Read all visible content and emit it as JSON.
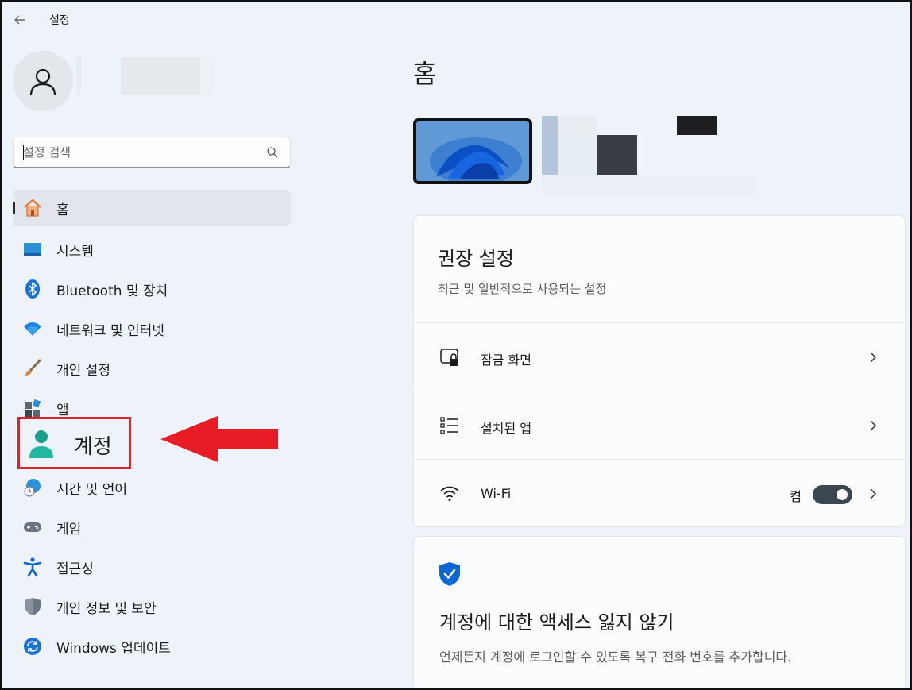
{
  "window": {
    "title": "설정"
  },
  "search": {
    "placeholder": "설정 검색"
  },
  "sidebar": {
    "items": [
      {
        "label": "홈",
        "icon": "home-icon",
        "active": true
      },
      {
        "label": "시스템",
        "icon": "system-icon"
      },
      {
        "label": "Bluetooth 및 장치",
        "icon": "bluetooth-icon"
      },
      {
        "label": "네트워크 및 인터넷",
        "icon": "wifi-icon"
      },
      {
        "label": "개인 설정",
        "icon": "brush-icon"
      },
      {
        "label": "앱",
        "icon": "apps-icon"
      },
      {
        "label": "계정",
        "icon": "account-icon",
        "highlighted": true
      },
      {
        "label": "시간 및 언어",
        "icon": "time-language-icon"
      },
      {
        "label": "게임",
        "icon": "gamepad-icon"
      },
      {
        "label": "접근성",
        "icon": "accessibility-icon"
      },
      {
        "label": "개인 정보 및 보안",
        "icon": "shield-icon"
      },
      {
        "label": "Windows 업데이트",
        "icon": "update-icon"
      }
    ]
  },
  "main": {
    "title": "홈",
    "recommended": {
      "title": "권장 설정",
      "subtitle": "최근 및 일반적으로 사용되는 설정",
      "rows": [
        {
          "label": "잠금 화면",
          "icon": "lock-screen-icon"
        },
        {
          "label": "설치된 앱",
          "icon": "installed-apps-icon"
        },
        {
          "label": "Wi-Fi",
          "icon": "wifi-icon",
          "state": "켬",
          "toggle_on": true
        }
      ]
    },
    "account_card": {
      "title": "계정에 대한 액세스 잃지 않기",
      "subtitle": "언제든지 계정에 로그인할 수 있도록 복구 전화 번호를 추가합니다."
    }
  },
  "colors": {
    "highlight_box": "#e0202a",
    "accent_blue": "#0a67d6",
    "toggle_on": "#3c4650"
  }
}
